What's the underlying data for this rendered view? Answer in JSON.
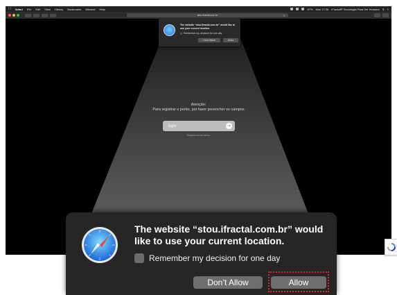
{
  "menubar": {
    "items": [
      "Safari",
      "File",
      "Edit",
      "View",
      "History",
      "Bookmarks",
      "Window",
      "Help"
    ],
    "status": {
      "battery": "97%",
      "datetime": "Mon 17:26",
      "user": "iFractal® Tecnologia Para Ser Humano"
    }
  },
  "toolbar": {
    "url": "stou.ifractal.com.br"
  },
  "page": {
    "heading": "Atenção:",
    "instruction": "Para registrar o ponto, por favor preencher os campos",
    "login_label": "login",
    "forgot_link": "Esqueci minha senha"
  },
  "permission_dialog": {
    "title": "The website “stou.ifractal.com.br” would like to use your current location.",
    "remember_label": "Remember my decision for one day",
    "remember_checked": false,
    "dont_allow_label": "Don’t Allow",
    "allow_label": "Allow"
  },
  "colors": {
    "dialog_bg": "#262626",
    "button_bg": "#6e6e6e",
    "highlight": "#e8202a"
  },
  "icons": [
    "apple-icon",
    "safari-compass-icon",
    "arrow-right-icon",
    "recaptcha-icon",
    "reload-icon"
  ]
}
